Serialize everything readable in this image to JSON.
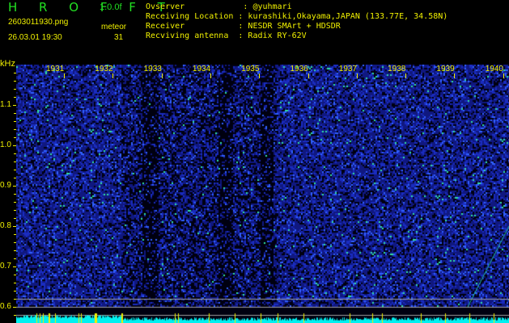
{
  "app_title": "H R O F F T",
  "version": "1.0.0f",
  "filename": "2603011930.png",
  "datetime": "26.03.01 19:30",
  "meteor_label": "meteor",
  "meteor_count": "31",
  "info": {
    "observer": "Ovserver            : @yuhmari",
    "location": "Receiving Location : kurashiki,Okayama,JAPAN (133.77E, 34.58N)",
    "receiver": "Receiver           : NESDR SMArt + HDSDR",
    "antenna": "Recviving antenna  : Radix RY-62V"
  },
  "y_unit": "kHz",
  "y_ticks": [
    "1.1",
    "1.0",
    "0.9",
    "0.8",
    "0.7",
    "0.6"
  ],
  "time_labels": [
    "1931",
    "1932",
    "1933",
    "1934",
    "1935",
    "1936",
    "1937",
    "1938",
    "1939",
    "1940"
  ],
  "colors": {
    "text": "#f0f000",
    "title": "#22e022",
    "trace": "#00f0f0",
    "grid": "#a0a0a0"
  }
}
